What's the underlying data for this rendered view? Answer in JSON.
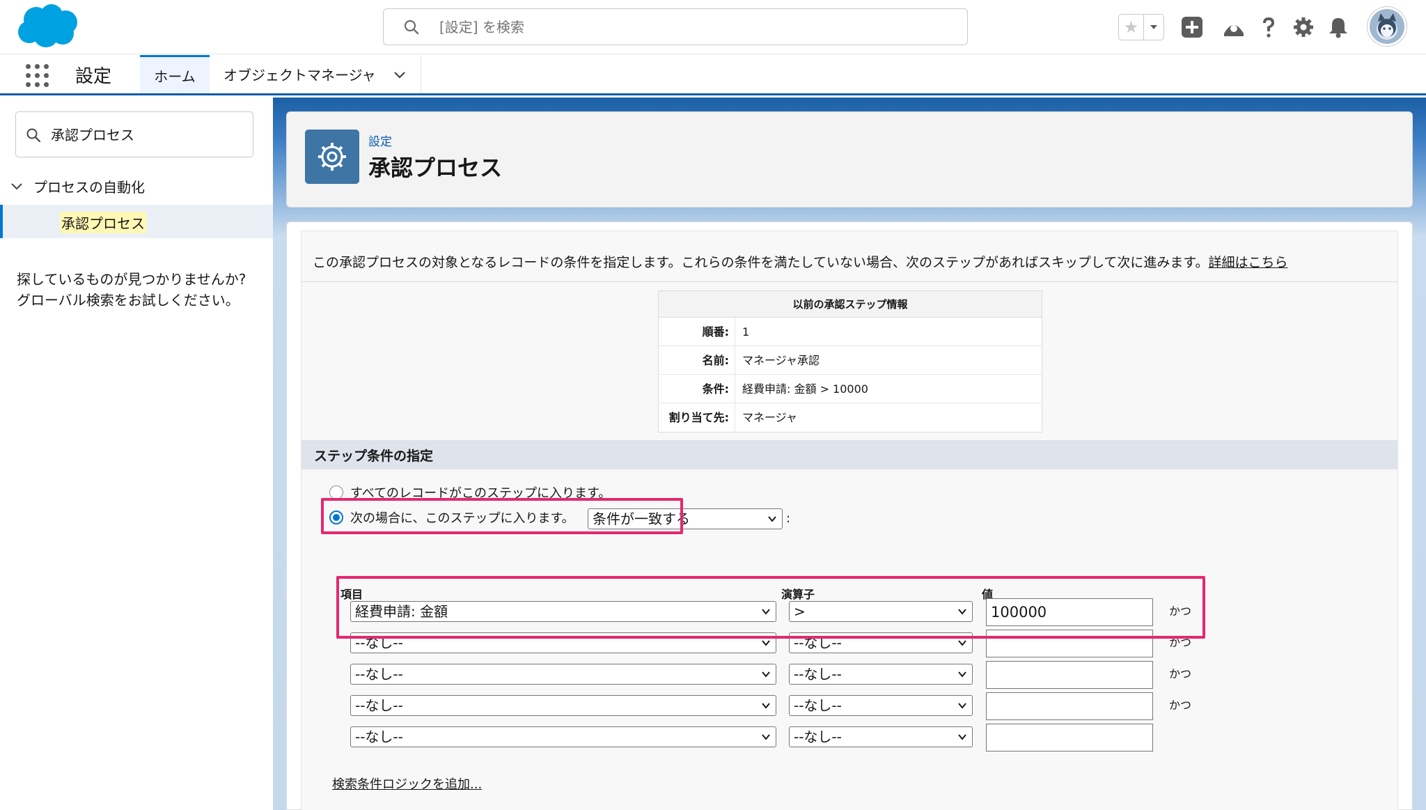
{
  "header": {
    "search_placeholder": "[設定] を検索",
    "icons": [
      "star-icon",
      "chevron-down-icon",
      "plus-icon",
      "trailhead-icon",
      "help-icon",
      "gear-icon",
      "bell-icon",
      "avatar"
    ]
  },
  "nav": {
    "app_name": "設定",
    "tabs": [
      {
        "label": "ホーム",
        "active": true
      },
      {
        "label": "オブジェクトマネージャ",
        "active": false
      }
    ]
  },
  "sidebar": {
    "search_value": "承認プロセス",
    "group_label": "プロセスの自動化",
    "active_item": "承認プロセス",
    "help_line1": "探しているものが見つかりませんか?",
    "help_line2": "グローバル検索をお試しください。"
  },
  "page_header": {
    "breadcrumb": "設定",
    "title": "承認プロセス"
  },
  "content": {
    "description": "この承認プロセスの対象となるレコードの条件を指定します。これらの条件を満たしていない場合、次のステップがあればスキップして次に進みます。",
    "details_link": "詳細はこちら",
    "prev_step": {
      "title": "以前の承認ステップ情報",
      "rows": [
        {
          "label": "順番:",
          "value": "1"
        },
        {
          "label": "名前:",
          "value": "マネージャ承認"
        },
        {
          "label": "条件:",
          "value": "経費申請: 金額 > 10000"
        },
        {
          "label": "割り当て先:",
          "value": "マネージャ"
        }
      ]
    },
    "section_title": "ステップ条件の指定",
    "radio_all": "すべてのレコードがこのステップに入ります。",
    "radio_cond": "次の場合に、このステップに入ります。",
    "cond_select": "条件が一致する",
    "cond_colon": ":",
    "col_field": "項目",
    "col_operator": "演算子",
    "col_value": "値",
    "criteria": [
      {
        "field": "経費申請: 金額",
        "operator": ">",
        "value": "100000",
        "conj": "かつ"
      },
      {
        "field": "--なし--",
        "operator": "--なし--",
        "value": "",
        "conj": "かつ"
      },
      {
        "field": "--なし--",
        "operator": "--なし--",
        "value": "",
        "conj": "かつ"
      },
      {
        "field": "--なし--",
        "operator": "--なし--",
        "value": "",
        "conj": "かつ"
      },
      {
        "field": "--なし--",
        "operator": "--なし--",
        "value": "",
        "conj": ""
      }
    ],
    "add_logic": "検索条件ロジックを追加..."
  },
  "colors": {
    "brand_blue": "#00a1e0",
    "highlight": "#e5286f",
    "accent": "#0176d3"
  }
}
